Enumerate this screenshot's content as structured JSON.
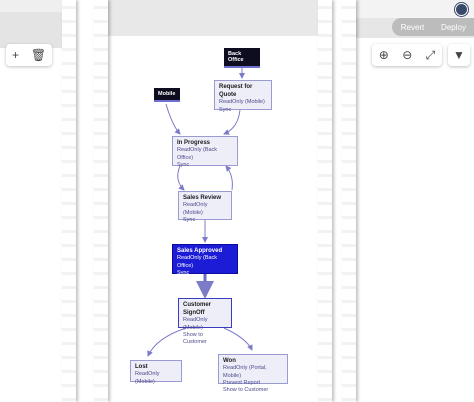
{
  "left_toolbar": {
    "add_icon": "+",
    "delete_icon": "🗑"
  },
  "right_toolbar": {
    "revert_label": "Revert",
    "deploy_label": "Deploy",
    "zoom_in_icon": "⊕",
    "zoom_out_icon": "⊖",
    "fit_icon": "⤢",
    "filter_icon": "▼"
  },
  "workflow": {
    "start_back_office": "Back Office",
    "start_mobile": "Mobile",
    "nodes": {
      "request_for_quote": {
        "title": "Request for Quote",
        "lines": [
          "ReadOnly (Mobile)",
          "Sync"
        ]
      },
      "in_progress": {
        "title": "In Progress",
        "lines": [
          "ReadOnly (Back Office)",
          "Sync"
        ]
      },
      "sales_review": {
        "title": "Sales Review",
        "lines": [
          "ReadOnly (Mobile)",
          "Sync"
        ]
      },
      "sales_approved": {
        "title": "Sales Approved",
        "lines": [
          "ReadOnly (Back Office)",
          "Sync"
        ]
      },
      "customer_signoff": {
        "title": "Customer SignOff",
        "lines": [
          "ReadOnly (Mobile)",
          "Show to Customer"
        ]
      },
      "lost": {
        "title": "Lost",
        "lines": [
          "ReadOnly (Mobile)"
        ]
      },
      "won": {
        "title": "Won",
        "lines": [
          "ReadOnly (Portal, Mobile)",
          "Prevent Report",
          "Show to Customer"
        ]
      }
    }
  },
  "colors": {
    "node_fill": "#eeeef9",
    "node_border": "#9b9bd3",
    "active_fill": "#1c1cd6",
    "arrow": "#7b7bc8"
  }
}
